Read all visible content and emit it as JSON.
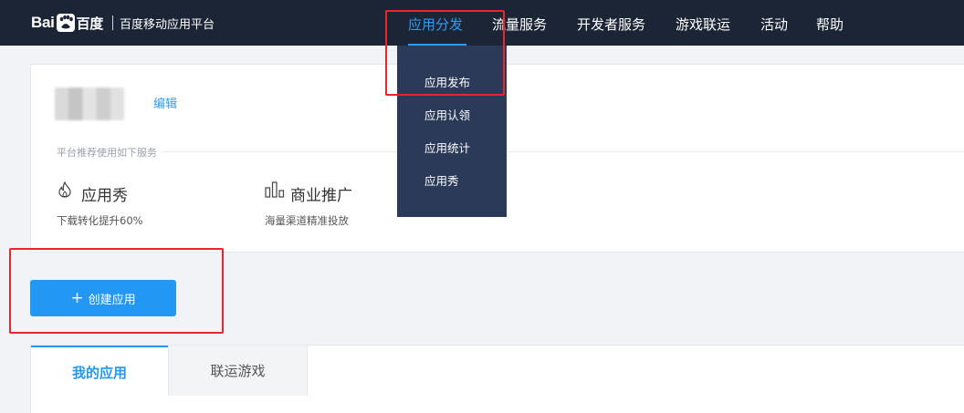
{
  "header": {
    "logo_text_left": "Bai",
    "logo_text_right": "百度",
    "platform_name": "百度移动应用平台",
    "nav": [
      {
        "label": "应用分发",
        "active": true
      },
      {
        "label": "流量服务",
        "active": false
      },
      {
        "label": "开发者服务",
        "active": false
      },
      {
        "label": "游戏联运",
        "active": false
      },
      {
        "label": "活动",
        "active": false
      },
      {
        "label": "帮助",
        "active": false
      }
    ]
  },
  "dropdown": {
    "items": [
      "应用发布",
      "应用认领",
      "应用统计",
      "应用秀"
    ]
  },
  "profile": {
    "edit_label": "编辑"
  },
  "services": {
    "title": "平台推荐使用如下服务",
    "items": [
      {
        "icon": "flame-icon",
        "title": "应用秀",
        "desc": "下载转化提升60%"
      },
      {
        "icon": "bar-chart-icon",
        "title": "商业推广",
        "desc": "海量渠道精准投放"
      }
    ]
  },
  "actions": {
    "create_label": "创建应用"
  },
  "tabs": [
    {
      "label": "我的应用",
      "active": true
    },
    {
      "label": "联运游戏",
      "active": false
    }
  ],
  "colors": {
    "header_bg": "#1b2536",
    "dropdown_bg": "#2b3a59",
    "accent": "#2297f3",
    "highlight": "#e8262b"
  }
}
